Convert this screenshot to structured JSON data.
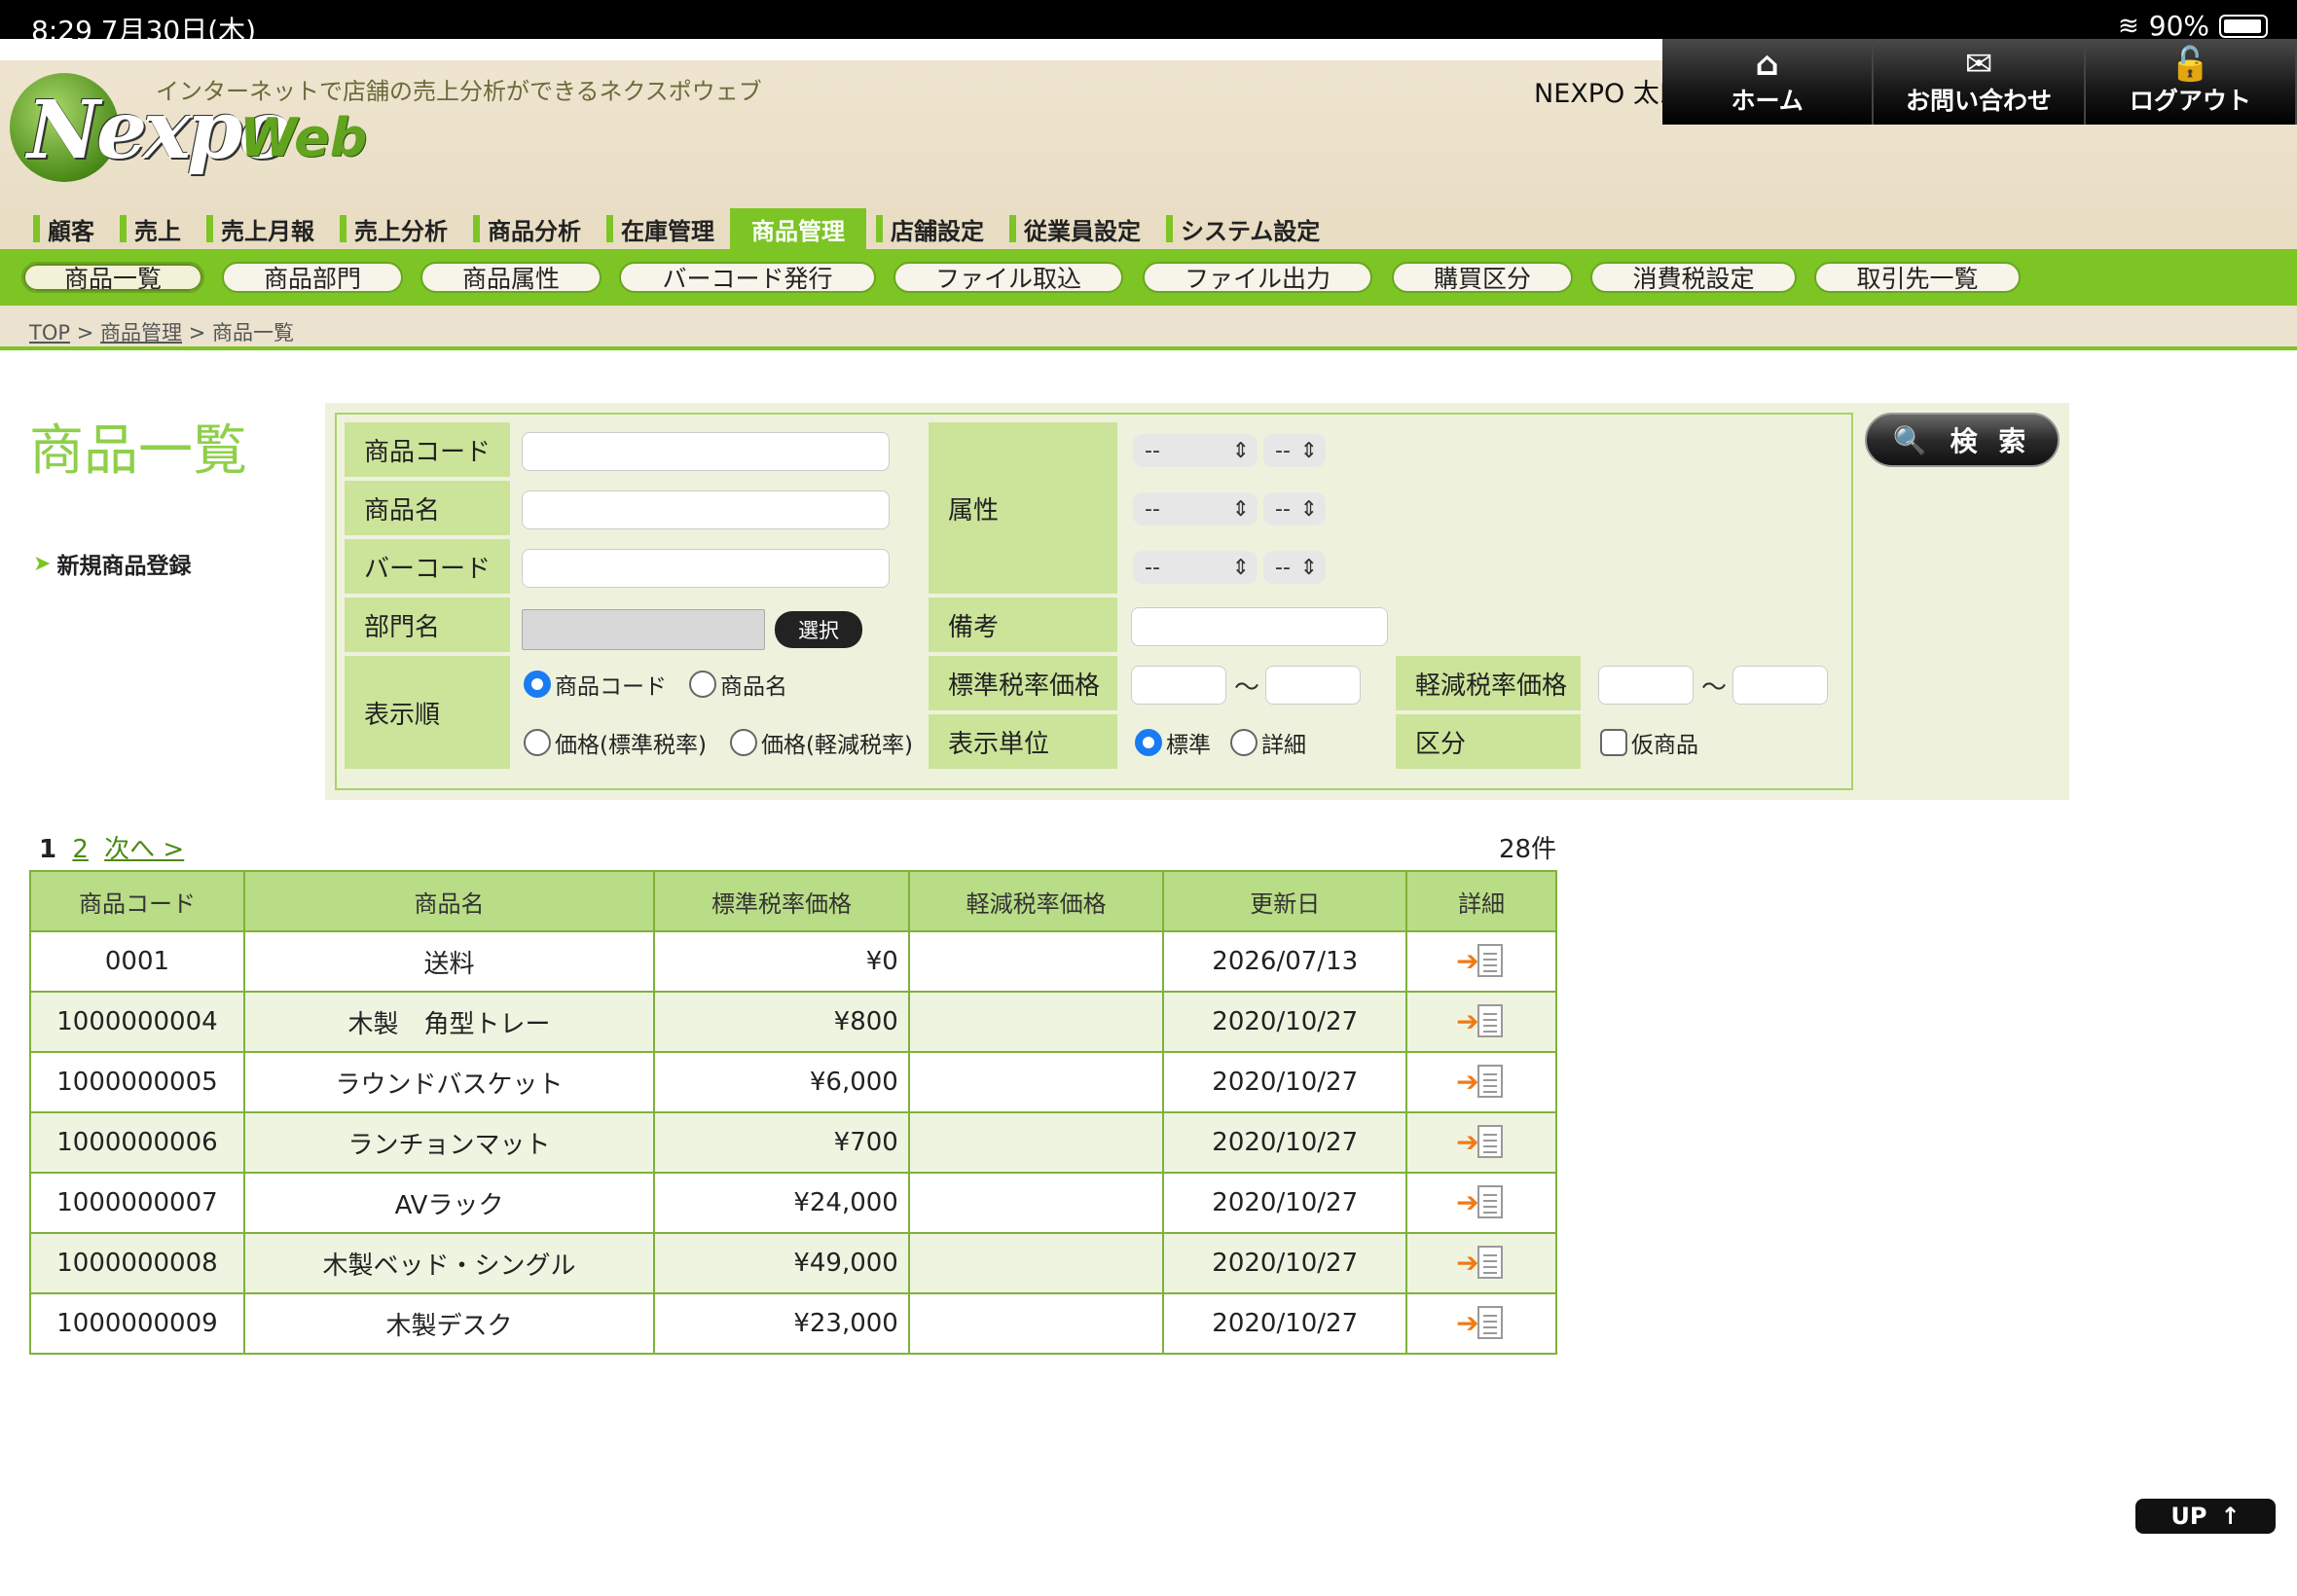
{
  "status_bar": {
    "time": "8:29 7月30日(木)",
    "battery": "90%",
    "wifi_icon": "wifi-icon",
    "battery_icon": "battery-icon"
  },
  "header": {
    "logo_text": "Nexpo",
    "logo_web": "Web",
    "tagline": "インターネットで店舗の売上分析ができるネクスポウェブ",
    "user": "NEXPO 太郎",
    "buttons": [
      {
        "label": "ホーム",
        "icon": "home-icon"
      },
      {
        "label": "お問い合わせ",
        "icon": "mail-icon"
      },
      {
        "label": "ログアウト",
        "icon": "unlock-icon"
      }
    ]
  },
  "tabs": [
    "顧客",
    "売上",
    "売上月報",
    "売上分析",
    "商品分析",
    "在庫管理",
    "商品管理",
    "店舗設定",
    "従業員設定",
    "システム設定"
  ],
  "active_tab": "商品管理",
  "subnav": [
    "商品一覧",
    "商品部門",
    "商品属性",
    "バーコード発行",
    "ファイル取込",
    "ファイル出力",
    "購買区分",
    "消費税設定",
    "取引先一覧"
  ],
  "breadcrumb": {
    "top": "TOP",
    "sep": ">",
    "section": "商品管理",
    "current": "商品一覧"
  },
  "page_title": "商品一覧",
  "new_link": "新規商品登録",
  "search": {
    "code_label": "商品コード",
    "name_label": "商品名",
    "barcode_label": "バーコード",
    "dept_label": "部門名",
    "select_button": "選択",
    "sort_label": "表示順",
    "sort_options": [
      "商品コード",
      "商品名",
      "価格(標準税率)",
      "価格(軽減税率)"
    ],
    "sort_selected": "商品コード",
    "attr_label": "属性",
    "attr_select_value": "--",
    "note_label": "備考",
    "std_price_label": "標準税率価格",
    "reduced_price_label": "軽減税率価格",
    "tilde": "〜",
    "unit_label": "表示単位",
    "unit_options": [
      "標準",
      "詳細"
    ],
    "unit_selected": "標準",
    "category_label": "区分",
    "provisional_label": "仮商品",
    "search_button": "検 索"
  },
  "pager": {
    "current": "1",
    "page2": "2",
    "next": "次へ >"
  },
  "count": "28件",
  "table": {
    "headers": [
      "商品コード",
      "商品名",
      "標準税率価格",
      "軽減税率価格",
      "更新日",
      "詳細"
    ],
    "rows": [
      {
        "code": "0001",
        "name": "送料",
        "std": "¥0",
        "reduced": "",
        "date": "2026/07/13"
      },
      {
        "code": "1000000004",
        "name": "木製　角型トレー",
        "std": "¥800",
        "reduced": "",
        "date": "2020/10/27"
      },
      {
        "code": "1000000005",
        "name": "ラウンドバスケット",
        "std": "¥6,000",
        "reduced": "",
        "date": "2020/10/27"
      },
      {
        "code": "1000000006",
        "name": "ランチョンマット",
        "std": "¥700",
        "reduced": "",
        "date": "2020/10/27"
      },
      {
        "code": "1000000007",
        "name": "AVラック",
        "std": "¥24,000",
        "reduced": "",
        "date": "2020/10/27"
      },
      {
        "code": "1000000008",
        "name": "木製ベッド・シングル",
        "std": "¥49,000",
        "reduced": "",
        "date": "2020/10/27"
      },
      {
        "code": "1000000009",
        "name": "木製デスク",
        "std": "¥23,000",
        "reduced": "",
        "date": "2020/10/27"
      }
    ]
  },
  "up_button": "UP",
  "colors": {
    "accent": "#7cc524",
    "header_bg": "#efe6d2",
    "label_bg": "#cbe49a",
    "radio": "#1a7cf2"
  }
}
